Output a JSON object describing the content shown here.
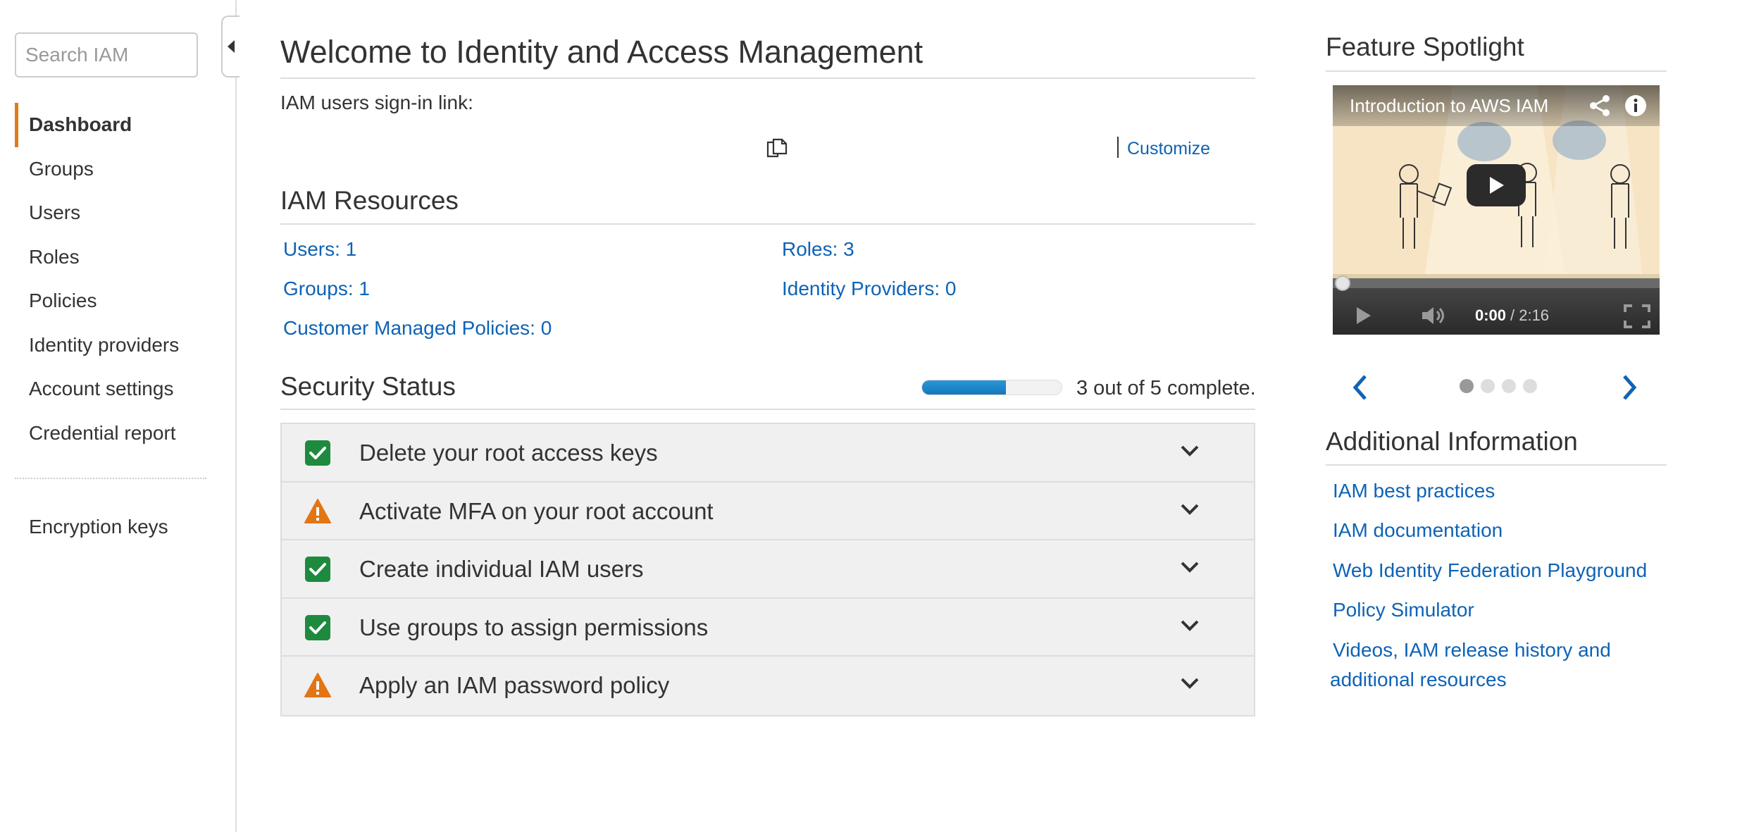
{
  "sidebar": {
    "search_placeholder": "Search IAM",
    "items": [
      {
        "label": "Dashboard",
        "active": true
      },
      {
        "label": "Groups"
      },
      {
        "label": "Users"
      },
      {
        "label": "Roles"
      },
      {
        "label": "Policies"
      },
      {
        "label": "Identity providers"
      },
      {
        "label": "Account settings"
      },
      {
        "label": "Credential report"
      }
    ],
    "extra_items": [
      {
        "label": "Encryption keys"
      }
    ]
  },
  "main": {
    "title": "Welcome to Identity and Access Management",
    "signin_label": "IAM users sign-in link:",
    "customize_label": "Customize",
    "resources": {
      "title": "IAM Resources",
      "users": "Users: 1",
      "roles": "Roles: 3",
      "groups": "Groups: 1",
      "identity_providers": "Identity Providers: 0",
      "customer_managed_policies": "Customer Managed Policies: 0"
    },
    "security": {
      "title": "Security Status",
      "completed": 3,
      "total": 5,
      "progress_text": "3 out of 5 complete.",
      "items": [
        {
          "label": "Delete your root access keys",
          "status": "complete"
        },
        {
          "label": "Activate MFA on your root account",
          "status": "warning"
        },
        {
          "label": "Create individual IAM users",
          "status": "complete"
        },
        {
          "label": "Use groups to assign permissions",
          "status": "complete"
        },
        {
          "label": "Apply an IAM password policy",
          "status": "warning"
        }
      ]
    }
  },
  "right": {
    "spotlight_title": "Feature Spotlight",
    "video": {
      "title": "Introduction to AWS IAM",
      "current_time": "0:00",
      "duration": "/ 2:16"
    },
    "carousel": {
      "pages": 4,
      "active": 0
    },
    "additional_title": "Additional Information",
    "links": [
      "IAM best practices",
      "IAM documentation",
      "Web Identity Federation Playground",
      "Policy Simulator",
      "Videos, IAM release history and",
      "additional resources"
    ]
  },
  "colors": {
    "link": "#0e63b6",
    "active_nav_accent": "#e07b1a",
    "success_green": "#1d8a3e",
    "warning_orange": "#e37514",
    "progress_blue": "#1e88cc"
  }
}
